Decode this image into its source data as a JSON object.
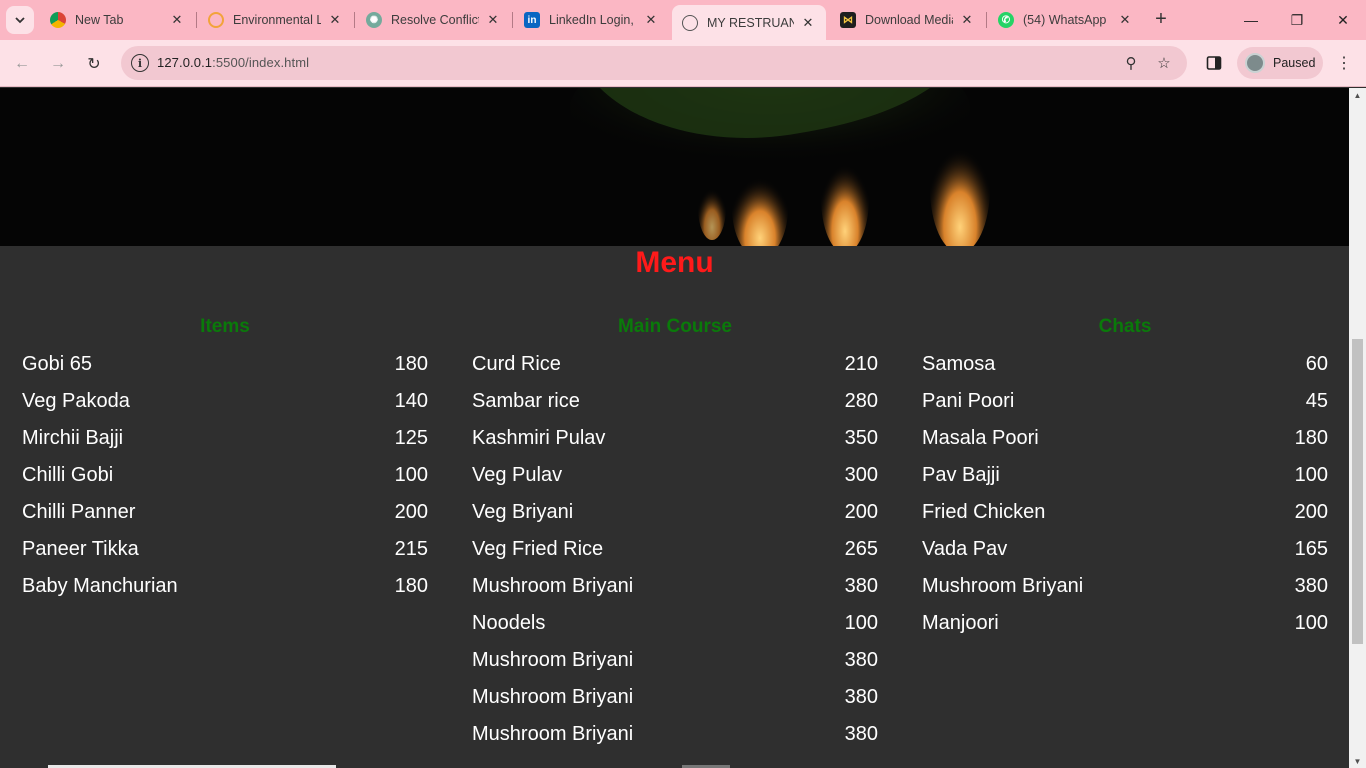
{
  "browser": {
    "tabs": [
      {
        "title": "New Tab",
        "icon": "chrome-icon",
        "active": false
      },
      {
        "title": "Environmental L",
        "icon": "environment-icon",
        "active": false
      },
      {
        "title": "Resolve Conflict",
        "icon": "chatgpt-icon",
        "active": false
      },
      {
        "title": "LinkedIn Login, S",
        "icon": "linkedin-icon",
        "active": false
      },
      {
        "title": "MY RESTRUANT",
        "icon": "globe-icon",
        "active": true
      },
      {
        "title": "Download Media",
        "icon": "media-icon",
        "active": false
      },
      {
        "title": "(54) WhatsApp",
        "icon": "whatsapp-icon",
        "active": false
      }
    ],
    "url_host": "127.0.0.1",
    "url_path": ":5500/index.html",
    "profile_status": "Paused",
    "colors": {
      "tabstrip": "#fbb7c4",
      "toolbar": "#fde1e7"
    }
  },
  "page": {
    "menu_title": "Menu",
    "colors": {
      "title": "#ff1a1a",
      "section": "#0a7a0a",
      "background": "#2f2f2f"
    },
    "sections": [
      {
        "title": "Items",
        "items": [
          {
            "name": "Gobi 65",
            "price": "180"
          },
          {
            "name": "Veg Pakoda",
            "price": "140"
          },
          {
            "name": "Mirchii Bajji",
            "price": "125"
          },
          {
            "name": "Chilli Gobi",
            "price": "100"
          },
          {
            "name": "Chilli Panner",
            "price": "200"
          },
          {
            "name": "Paneer Tikka",
            "price": "215"
          },
          {
            "name": "Baby Manchurian",
            "price": "180"
          }
        ]
      },
      {
        "title": "Main Course",
        "items": [
          {
            "name": "Curd Rice",
            "price": "210"
          },
          {
            "name": "Sambar rice",
            "price": "280"
          },
          {
            "name": "Kashmiri Pulav",
            "price": "350"
          },
          {
            "name": "Veg Pulav",
            "price": "300"
          },
          {
            "name": "Veg Briyani",
            "price": "200"
          },
          {
            "name": "Veg Fried Rice",
            "price": "265"
          },
          {
            "name": "Mushroom Briyani",
            "price": "380"
          },
          {
            "name": "Noodels",
            "price": "100"
          },
          {
            "name": "Mushroom Briyani",
            "price": "380"
          },
          {
            "name": "Mushroom Briyani",
            "price": "380"
          },
          {
            "name": "Mushroom Briyani",
            "price": "380"
          }
        ]
      },
      {
        "title": "Chats",
        "items": [
          {
            "name": "Samosa",
            "price": "60"
          },
          {
            "name": "Pani Poori",
            "price": "45"
          },
          {
            "name": "Masala Poori",
            "price": "180"
          },
          {
            "name": "Pav Bajji",
            "price": "100"
          },
          {
            "name": "Fried Chicken",
            "price": "200"
          },
          {
            "name": "Vada Pav",
            "price": "165"
          },
          {
            "name": "Mushroom Briyani",
            "price": "380"
          },
          {
            "name": "Manjoori",
            "price": "100"
          }
        ]
      }
    ]
  }
}
